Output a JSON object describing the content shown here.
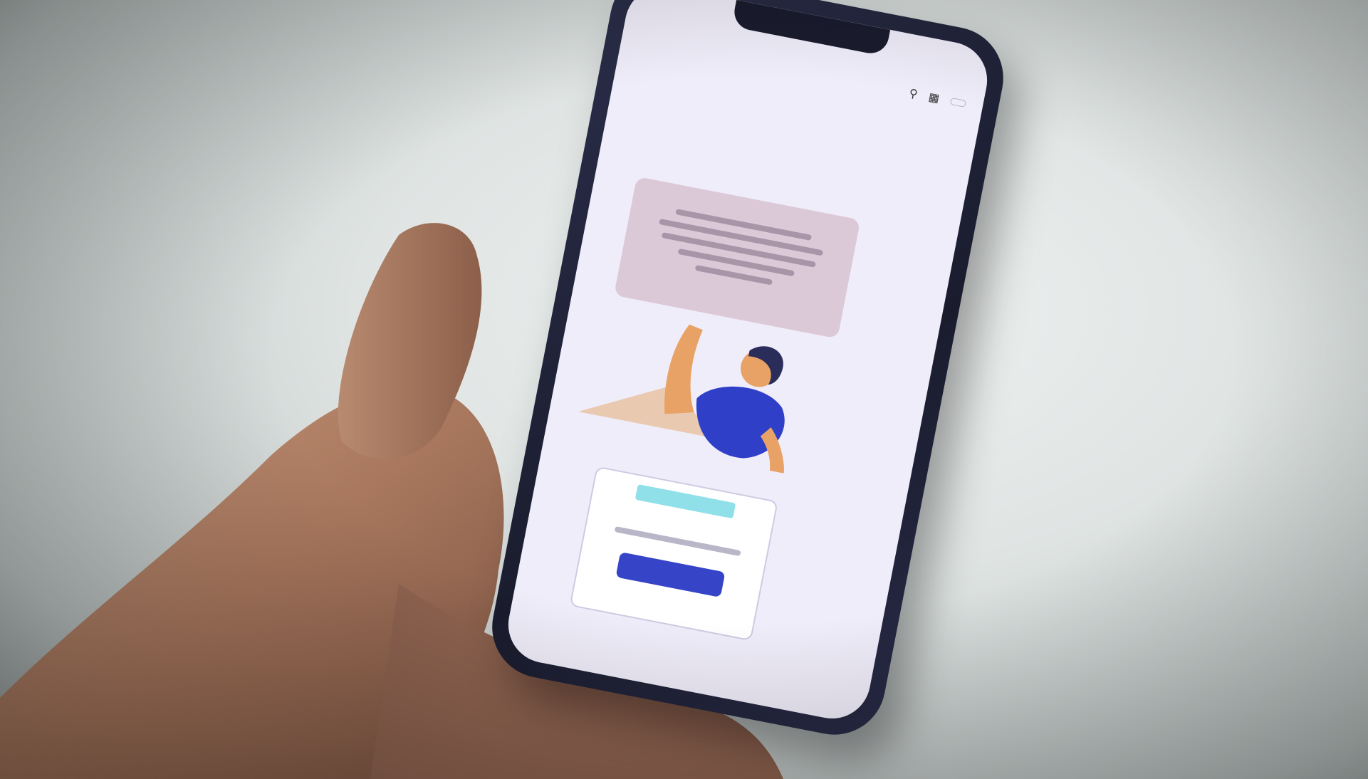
{
  "scene": {
    "description_icons": [
      "hand-holding-phone",
      "smartphone"
    ],
    "background_color": "#dfe4e3",
    "phone_frame_color": "#1a1c2e",
    "screen_bg_color": "#f0edfa"
  },
  "phone_screen": {
    "status_time": "",
    "status_signal": "",
    "app_logo": "",
    "header_button": "",
    "breadcrumb": "",
    "sub_nav": "",
    "page_title": "",
    "callout_color": "#dcc9d8",
    "illustration_shirt_color": "#2f3fc8",
    "illustration_skin_color": "#e8a266",
    "section_label": "",
    "card_badge_color": "#8fe0e8",
    "card_button_color": "#3645c8",
    "card_button_label": ""
  }
}
